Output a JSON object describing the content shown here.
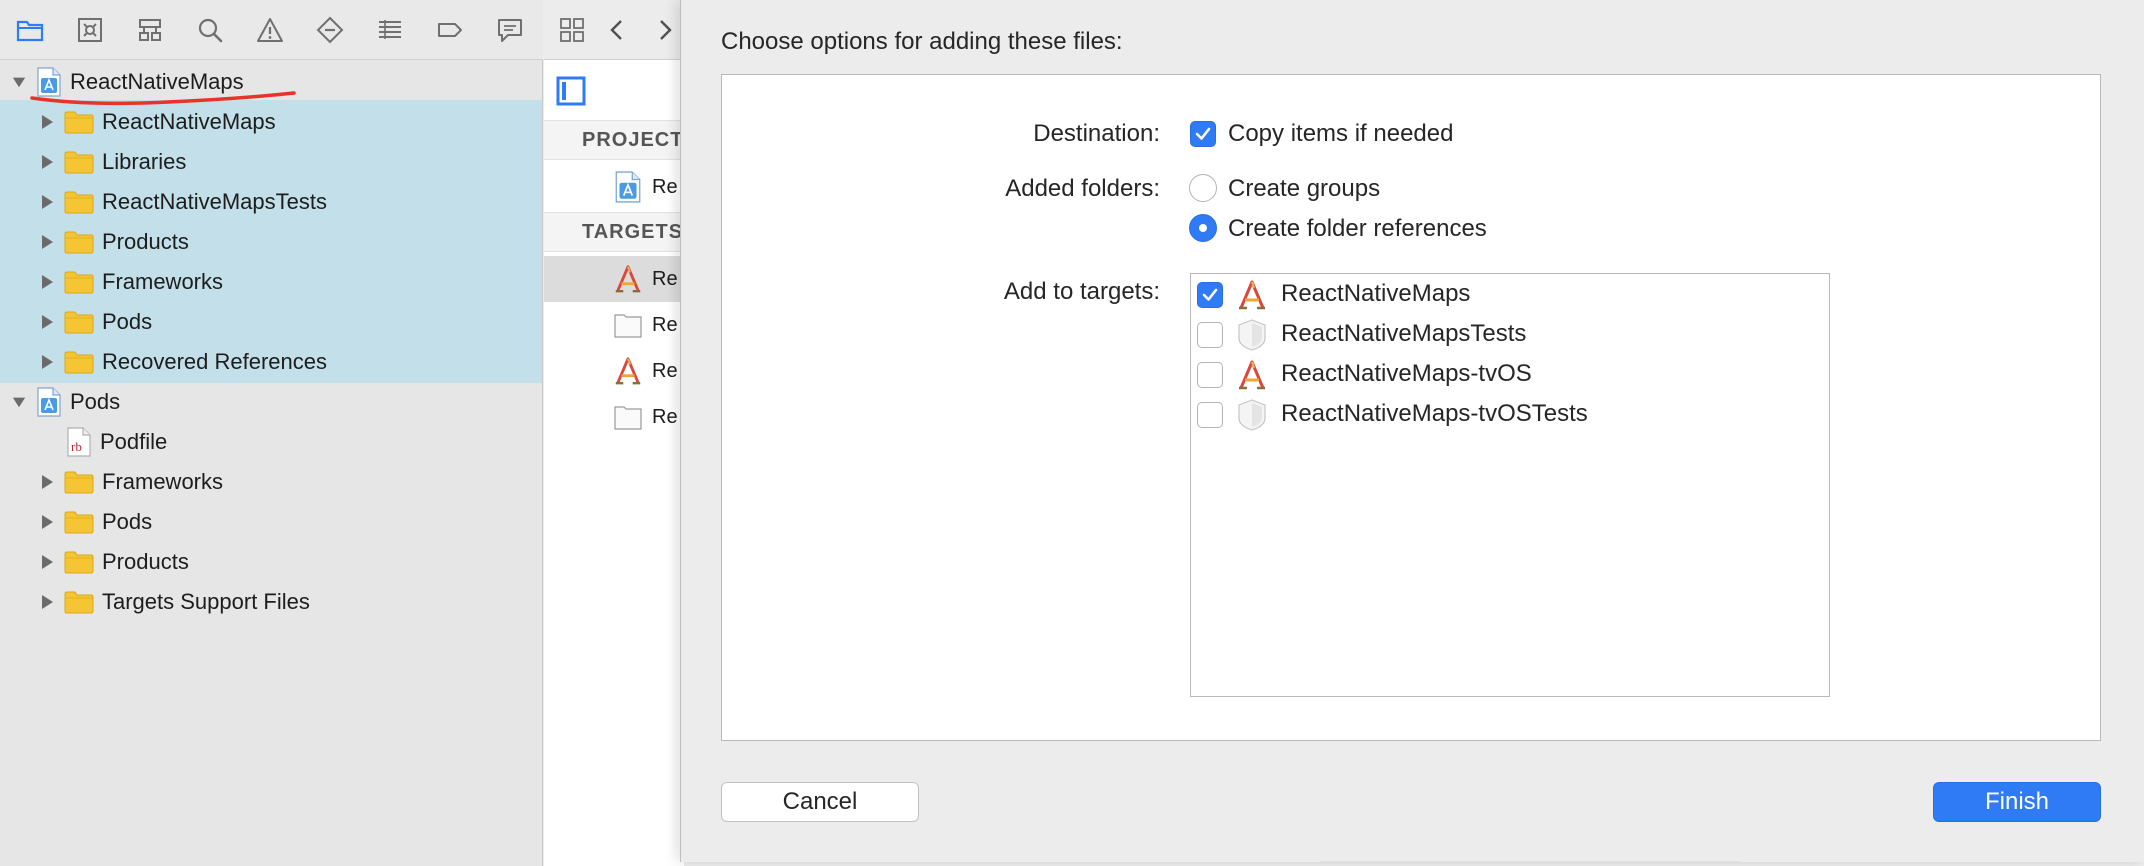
{
  "navigator": {
    "tree": [
      {
        "label": "ReactNativeMaps",
        "kind": "project",
        "expanded": true
      },
      {
        "label": "ReactNativeMaps",
        "kind": "folder"
      },
      {
        "label": "Libraries",
        "kind": "folder"
      },
      {
        "label": "ReactNativeMapsTests",
        "kind": "folder"
      },
      {
        "label": "Products",
        "kind": "folder"
      },
      {
        "label": "Frameworks",
        "kind": "folder"
      },
      {
        "label": "Pods",
        "kind": "folder"
      },
      {
        "label": "Recovered References",
        "kind": "folder"
      },
      {
        "label": "Pods",
        "kind": "project",
        "expanded": true
      },
      {
        "label": "Podfile",
        "kind": "ruby-file",
        "icon_text": "rb"
      },
      {
        "label": "Frameworks",
        "kind": "folder"
      },
      {
        "label": "Pods",
        "kind": "folder"
      },
      {
        "label": "Products",
        "kind": "folder"
      },
      {
        "label": "Targets Support Files",
        "kind": "folder"
      }
    ]
  },
  "editor": {
    "project_header": "PROJECT",
    "targets_header": "TARGETS",
    "project_item": "Re",
    "target_items": [
      "Re",
      "Re",
      "Re",
      "Re"
    ]
  },
  "sheet": {
    "title": "Choose options for adding these files:",
    "destination": {
      "label": "Destination:",
      "option": "Copy items if needed",
      "checked": true
    },
    "added_folders": {
      "label": "Added folders:",
      "options": [
        {
          "label": "Create groups",
          "selected": false
        },
        {
          "label": "Create folder references",
          "selected": true
        }
      ]
    },
    "add_to_targets": {
      "label": "Add to targets:",
      "targets": [
        {
          "name": "ReactNativeMaps",
          "checked": true,
          "icon": "app-target-icon"
        },
        {
          "name": "ReactNativeMapsTests",
          "checked": false,
          "icon": "test-bundle-icon"
        },
        {
          "name": "ReactNativeMaps-tvOS",
          "checked": false,
          "icon": "app-target-icon"
        },
        {
          "name": "ReactNativeMaps-tvOSTests",
          "checked": false,
          "icon": "test-bundle-icon"
        }
      ]
    },
    "cancel_label": "Cancel",
    "finish_label": "Finish"
  },
  "colors": {
    "accent": "#2f7bf5",
    "folder": "#f5c533",
    "selection_highlight": "#c3dfe9",
    "annotation_red": "#e8332a"
  }
}
